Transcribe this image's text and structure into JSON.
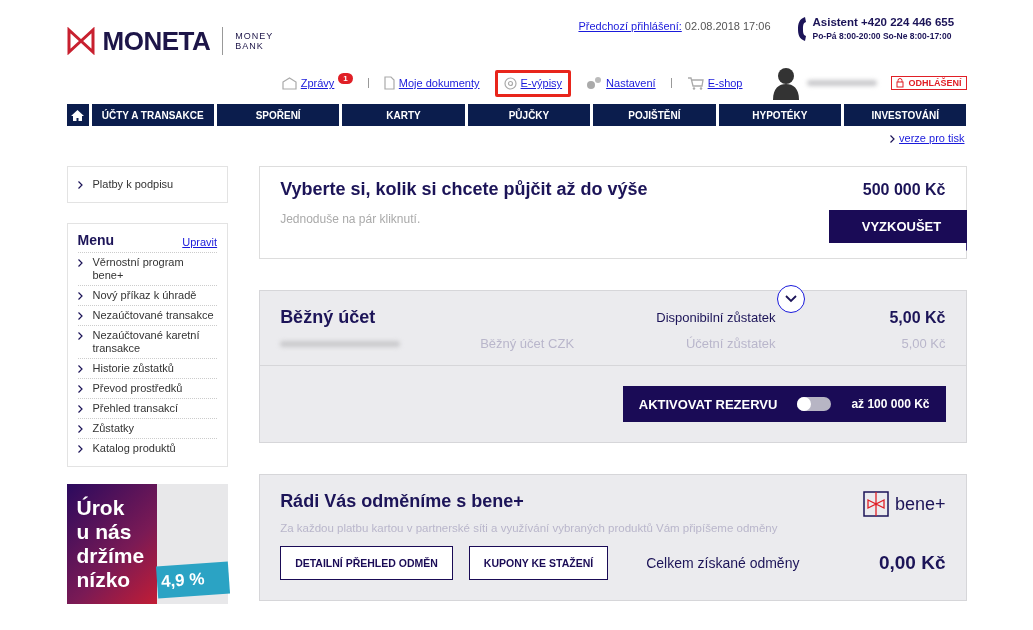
{
  "logo": {
    "name": "MONETA",
    "tagline_1": "MONEY",
    "tagline_2": "BANK"
  },
  "previous_login": {
    "label": "Předchozí přihlášení:",
    "value": "02.08.2018 17:06"
  },
  "assistant": {
    "phone": "Asistent +420 224 446 655",
    "hours": "Po-Pá 8:00-20:00 So-Ne 8:00-17:00"
  },
  "top_links": [
    {
      "kind": "messages",
      "label": "Zprávy",
      "badge": "1",
      "highlighted": false
    },
    {
      "kind": "documents",
      "label": "Moje dokumenty",
      "highlighted": false
    },
    {
      "kind": "statements",
      "label": "E-výpisy",
      "highlighted": true
    },
    {
      "kind": "settings",
      "label": "Nastavení",
      "highlighted": false
    },
    {
      "kind": "shop",
      "label": "E-shop",
      "highlighted": false
    }
  ],
  "logout": "ODHLÁŠENÍ",
  "nav": [
    {
      "label": "ÚČTY A TRANSAKCE",
      "selected": false
    },
    {
      "label": "SPOŘENÍ",
      "selected": false
    },
    {
      "label": "KARTY",
      "selected": false
    },
    {
      "label": "PŮJČKY",
      "selected": false
    },
    {
      "label": "POJIŠTĚNÍ",
      "selected": false
    },
    {
      "label": "HYPOTÉKY",
      "selected": false
    },
    {
      "label": "INVESTOVÁNÍ",
      "selected": false
    }
  ],
  "print_link": "verze pro tisk",
  "sidebar": {
    "pending": "Platby k podpisu",
    "menu_title": "Menu",
    "edit": "Upravit",
    "items": [
      "Věrnostní program bene+",
      "Nový příkaz k úhradě",
      "Nezaúčtované transakce",
      "Nezaúčtované karetní transakce",
      "Historie zůstatků",
      "Převod prostředků",
      "Přehled transakcí",
      "Zůstatky",
      "Katalog produktů"
    ],
    "banner": {
      "lines": [
        "Úrok",
        "u nás",
        "držíme",
        "nízko"
      ],
      "rate": "4,9 %"
    }
  },
  "offer": {
    "title": "Vyberte si, kolik si chcete půjčit až do výše",
    "amount": "500 000 Kč",
    "subtitle": "Jednoduše na pár kliknutí.",
    "button": "VYZKOUŠET"
  },
  "account": {
    "name": "Běžný účet",
    "type": "Běžný účet CZK",
    "available_label": "Disponibilní zůstatek",
    "available": "5,00 Kč",
    "ledger_label": "Účetní zůstatek",
    "ledger": "5,00 Kč",
    "reserve": {
      "label": "AKTIVOVAT REZERVU",
      "on": false,
      "limit": "až 100 000 Kč"
    }
  },
  "rewards": {
    "title": "Rádi Vás odměníme s bene+",
    "text": "Za každou platbu kartou v partnerské síti a využívání vybraných produktů Vám připíšeme odměny",
    "brand": "bene+",
    "buttons": [
      "DETAILNÍ PŘEHLED ODMĚN",
      "KUPONY KE STAŽENÍ"
    ],
    "total_label": "Celkem získané odměny",
    "total": "0,00 Kč"
  }
}
